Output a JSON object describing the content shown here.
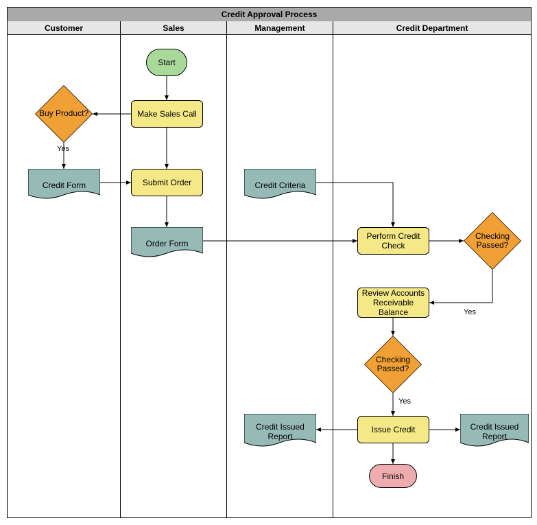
{
  "title": "Credit Approval Process",
  "lanes": {
    "customer": "Customer",
    "sales": "Sales",
    "management": "Management",
    "credit_dept": "Credit Department"
  },
  "nodes": {
    "start": "Start",
    "make_sales_call": "Make Sales Call",
    "buy_product": "Buy Product?",
    "credit_form": "Credit Form",
    "submit_order": "Submit Order",
    "order_form": "Order Form",
    "credit_criteria": "Credit Criteria",
    "perform_credit_check": "Perform Credit Check",
    "checking_passed_1": "Checking Passed?",
    "review_ar_balance": "Review Accounts Receivable Balance",
    "checking_passed_2": "Checking Passed?",
    "issue_credit": "Issue Credit",
    "credit_issued_report_left": "Credit Issued Report",
    "credit_issued_report_right": "Credit Issued Report",
    "finish": "Finish"
  },
  "edge_labels": {
    "yes1": "Yes",
    "yes2": "Yes",
    "yes3": "Yes"
  },
  "chart_data": {
    "type": "flowchart_swimlane",
    "title": "Credit Approval Process",
    "lanes": [
      "Customer",
      "Sales",
      "Management",
      "Credit Department"
    ],
    "nodes": [
      {
        "id": "start",
        "label": "Start",
        "type": "terminator",
        "lane": "Sales"
      },
      {
        "id": "make_sales_call",
        "label": "Make Sales Call",
        "type": "process",
        "lane": "Sales"
      },
      {
        "id": "buy_product",
        "label": "Buy Product?",
        "type": "decision",
        "lane": "Customer"
      },
      {
        "id": "credit_form",
        "label": "Credit Form",
        "type": "document",
        "lane": "Customer"
      },
      {
        "id": "submit_order",
        "label": "Submit Order",
        "type": "process",
        "lane": "Sales"
      },
      {
        "id": "order_form",
        "label": "Order Form",
        "type": "document",
        "lane": "Sales"
      },
      {
        "id": "credit_criteria",
        "label": "Credit Criteria",
        "type": "document",
        "lane": "Management"
      },
      {
        "id": "perform_credit_check",
        "label": "Perform Credit Check",
        "type": "process",
        "lane": "Credit Department"
      },
      {
        "id": "checking_passed_1",
        "label": "Checking Passed?",
        "type": "decision",
        "lane": "Credit Department"
      },
      {
        "id": "review_ar_balance",
        "label": "Review Accounts Receivable Balance",
        "type": "process",
        "lane": "Credit Department"
      },
      {
        "id": "checking_passed_2",
        "label": "Checking Passed?",
        "type": "decision",
        "lane": "Credit Department"
      },
      {
        "id": "issue_credit",
        "label": "Issue Credit",
        "type": "process",
        "lane": "Credit Department"
      },
      {
        "id": "credit_issued_report_left",
        "label": "Credit Issued Report",
        "type": "document",
        "lane": "Management"
      },
      {
        "id": "credit_issued_report_right",
        "label": "Credit Issued Report",
        "type": "document",
        "lane": "Credit Department"
      },
      {
        "id": "finish",
        "label": "Finish",
        "type": "terminator",
        "lane": "Credit Department"
      }
    ],
    "edges": [
      {
        "from": "start",
        "to": "make_sales_call"
      },
      {
        "from": "make_sales_call",
        "to": "buy_product"
      },
      {
        "from": "buy_product",
        "to": "credit_form",
        "label": "Yes"
      },
      {
        "from": "credit_form",
        "to": "submit_order"
      },
      {
        "from": "make_sales_call",
        "to": "submit_order"
      },
      {
        "from": "submit_order",
        "to": "order_form"
      },
      {
        "from": "order_form",
        "to": "perform_credit_check"
      },
      {
        "from": "credit_criteria",
        "to": "perform_credit_check"
      },
      {
        "from": "perform_credit_check",
        "to": "checking_passed_1"
      },
      {
        "from": "checking_passed_1",
        "to": "review_ar_balance",
        "label": "Yes"
      },
      {
        "from": "review_ar_balance",
        "to": "checking_passed_2"
      },
      {
        "from": "checking_passed_2",
        "to": "issue_credit",
        "label": "Yes"
      },
      {
        "from": "issue_credit",
        "to": "credit_issued_report_left"
      },
      {
        "from": "issue_credit",
        "to": "credit_issued_report_right"
      },
      {
        "from": "issue_credit",
        "to": "finish"
      }
    ]
  }
}
